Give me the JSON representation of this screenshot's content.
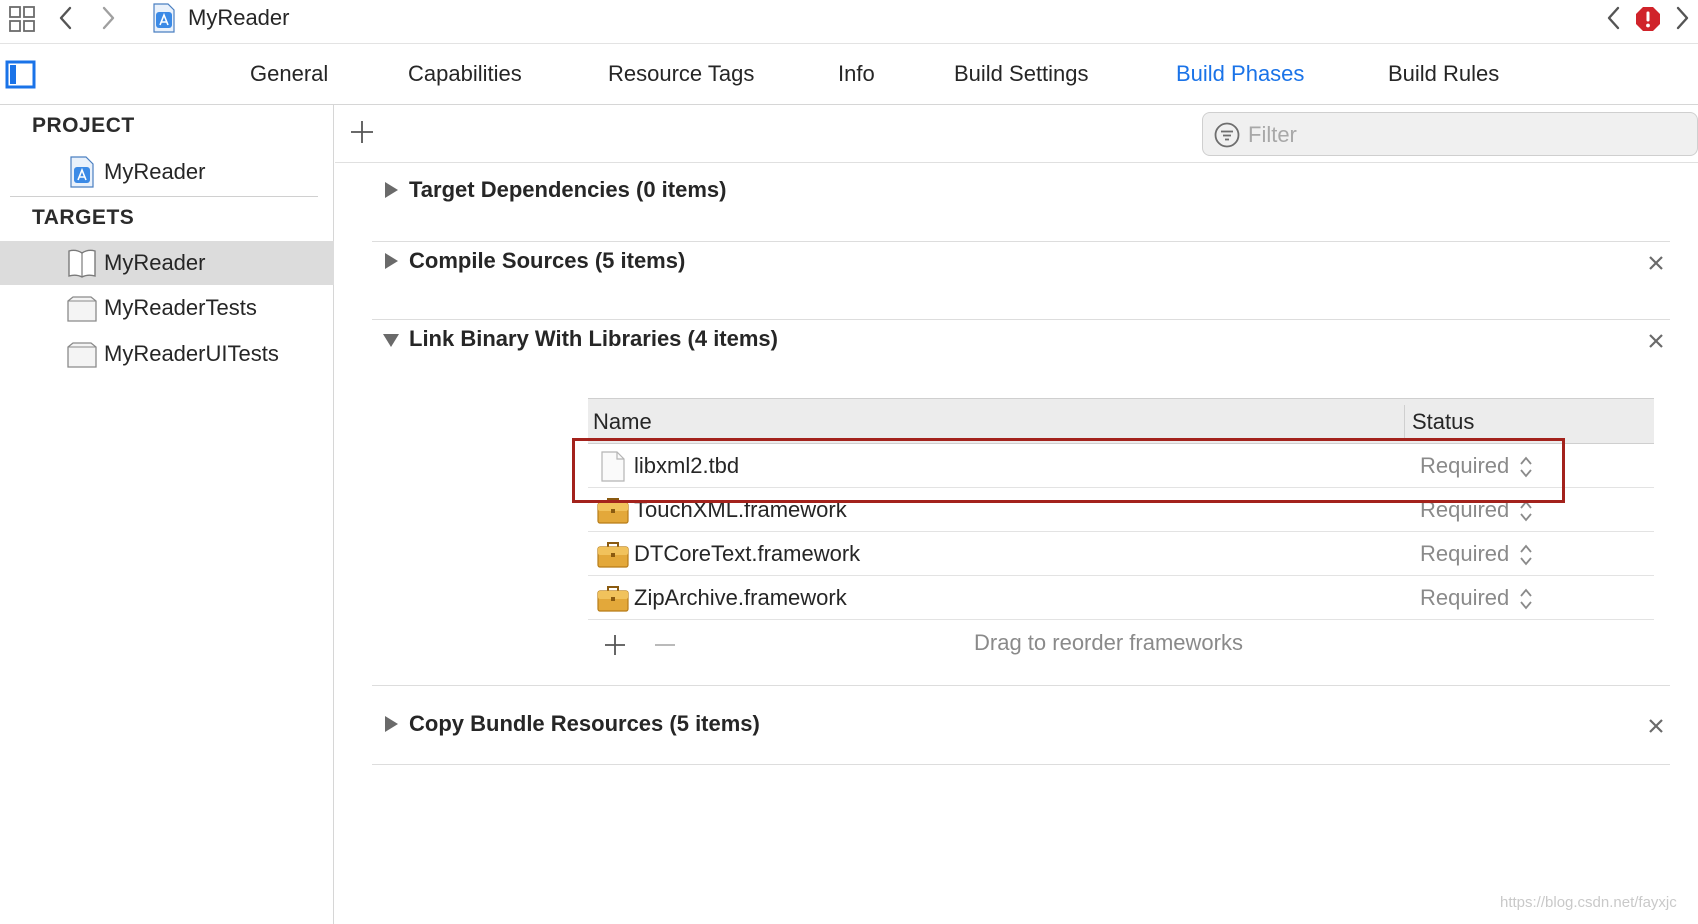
{
  "jumpbar": {
    "title": "MyReader"
  },
  "tabs": [
    {
      "label": "General"
    },
    {
      "label": "Capabilities"
    },
    {
      "label": "Resource Tags"
    },
    {
      "label": "Info"
    },
    {
      "label": "Build Settings"
    },
    {
      "label": "Build Phases"
    },
    {
      "label": "Build Rules"
    }
  ],
  "active_tab": "Build Phases",
  "sidebar": {
    "project_header": "PROJECT",
    "project_item": "MyReader",
    "targets_header": "TARGETS",
    "targets": [
      {
        "label": "MyReader",
        "selected": true
      },
      {
        "label": "MyReaderTests",
        "selected": false
      },
      {
        "label": "MyReaderUITests",
        "selected": false
      }
    ]
  },
  "filter": {
    "placeholder": "Filter"
  },
  "phases": [
    {
      "title": "Target Dependencies (0 items)",
      "expanded": false,
      "closable": false
    },
    {
      "title": "Compile Sources (5 items)",
      "expanded": false,
      "closable": true
    },
    {
      "title": "Link Binary With Libraries (4 items)",
      "expanded": true,
      "closable": true
    },
    {
      "title": "Copy Bundle Resources (5 items)",
      "expanded": false,
      "closable": true
    }
  ],
  "libraries": {
    "columns": {
      "name": "Name",
      "status": "Status"
    },
    "rows": [
      {
        "name": "libxml2.tbd",
        "status": "Required",
        "icon": "document-icon"
      },
      {
        "name": "TouchXML.framework",
        "status": "Required",
        "icon": "framework-toolbox-icon"
      },
      {
        "name": "DTCoreText.framework",
        "status": "Required",
        "icon": "framework-toolbox-icon"
      },
      {
        "name": "ZipArchive.framework",
        "status": "Required",
        "icon": "framework-toolbox-icon"
      }
    ],
    "footer_hint": "Drag to reorder frameworks"
  },
  "colors": {
    "accent": "#1a73e8",
    "highlight_box": "#a3221c",
    "error": "#d0232a",
    "framework_icon": "#e3a83a"
  },
  "watermark": "https://blog.csdn.net/fayxjc"
}
